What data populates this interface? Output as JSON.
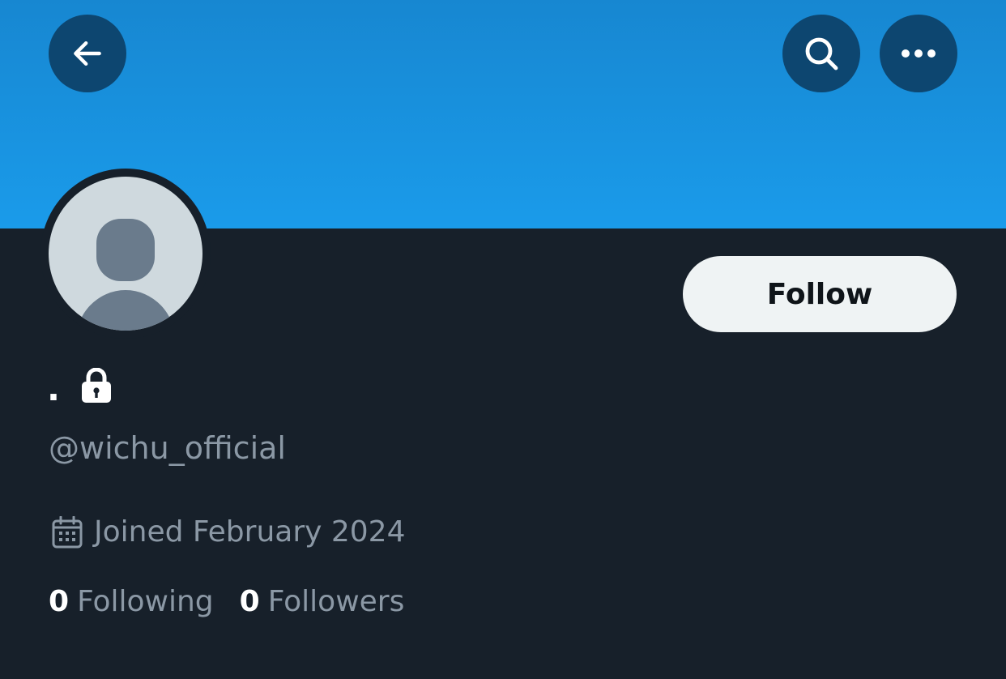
{
  "header": {
    "back_icon": "arrow-left-icon",
    "search_icon": "search-icon",
    "more_icon": "more-horizontal-icon",
    "banner_color": "#1a9bea",
    "button_color": "#0d4670"
  },
  "profile": {
    "display_name": ".",
    "protected_icon": "lock-icon",
    "handle": "@wichu_official",
    "joined_icon": "calendar-icon",
    "joined": "Joined February 2024",
    "follow_label": "Follow"
  },
  "stats": {
    "following_count": "0",
    "following_label": "Following",
    "followers_count": "0",
    "followers_label": "Followers"
  },
  "colors": {
    "background": "#17202a",
    "secondary_text": "#8b98a5",
    "follow_button": "#eff3f4"
  }
}
